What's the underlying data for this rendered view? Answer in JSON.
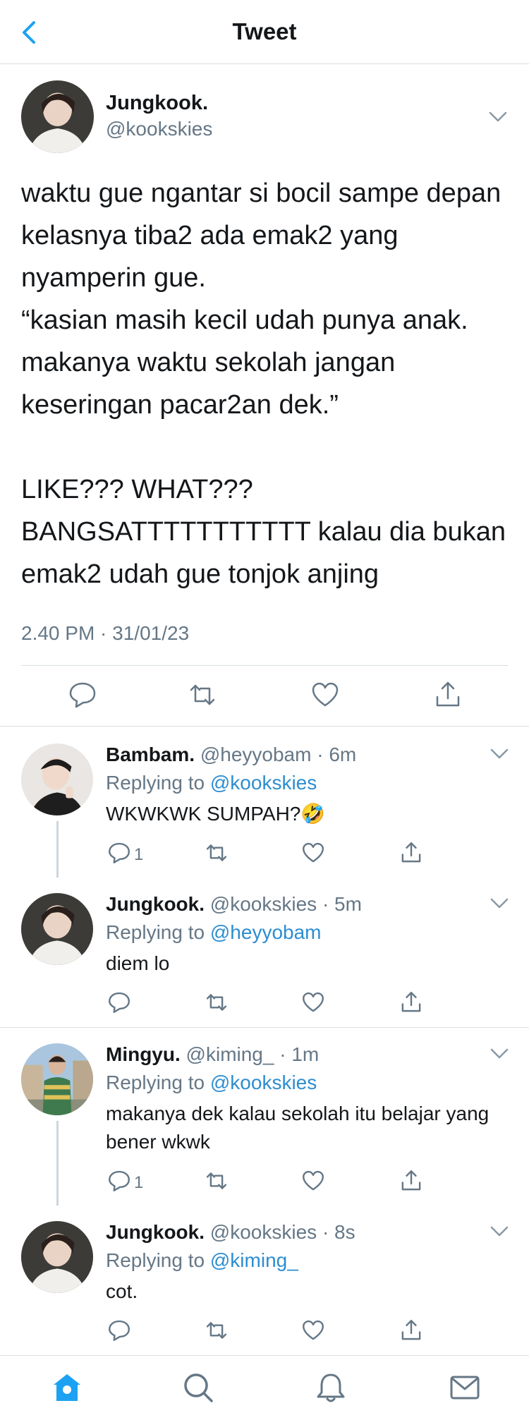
{
  "header": {
    "title": "Tweet"
  },
  "main_tweet": {
    "name": "Jungkook.",
    "handle": "@kookskies",
    "text": "waktu gue ngantar si bocil sampe depan kelasnya tiba2 ada emak2 yang nyamperin gue.\n“kasian masih kecil udah punya anak. makanya waktu sekolah jangan keseringan pacar2an dek.”\n\nLIKE??? WHAT???\nBANGSATTTTTTTTTTT kalau dia bukan emak2 udah gue tonjok anjing",
    "timestamp": "2.40 PM · 31/01/23"
  },
  "replies": [
    {
      "name": "Bambam.",
      "meta": "@heyyobam · 6m",
      "replying_prefix": "Replying to",
      "replying_to": "@kookskies",
      "text": "WKWKWK SUMPAH?🤣",
      "reply_count": "1"
    },
    {
      "name": "Jungkook.",
      "meta": "@kookskies · 5m",
      "replying_prefix": "Replying to",
      "replying_to": "@heyyobam",
      "text": "diem lo",
      "reply_count": ""
    },
    {
      "name": "Mingyu.",
      "meta": "@kiming_ · 1m",
      "replying_prefix": "Replying to",
      "replying_to": "@kookskies",
      "text": "makanya dek kalau sekolah itu belajar yang bener wkwk",
      "reply_count": "1"
    },
    {
      "name": "Jungkook.",
      "meta": "@kookskies · 8s",
      "replying_prefix": "Replying to",
      "replying_to": "@kiming_",
      "text": "cot.",
      "reply_count": ""
    }
  ],
  "icons": {
    "back": "chevron-left-icon",
    "more": "chevron-down-icon",
    "reply": "comment-icon",
    "retweet": "retweet-icon",
    "like": "heart-icon",
    "share": "share-icon",
    "home": "home-icon",
    "search": "search-icon",
    "notifications": "bell-icon",
    "messages": "mail-icon"
  },
  "colors": {
    "accent": "#1da1f2",
    "mention": "#2d8dd0",
    "secondary_text": "#657786",
    "divider": "#d9dfe3"
  }
}
